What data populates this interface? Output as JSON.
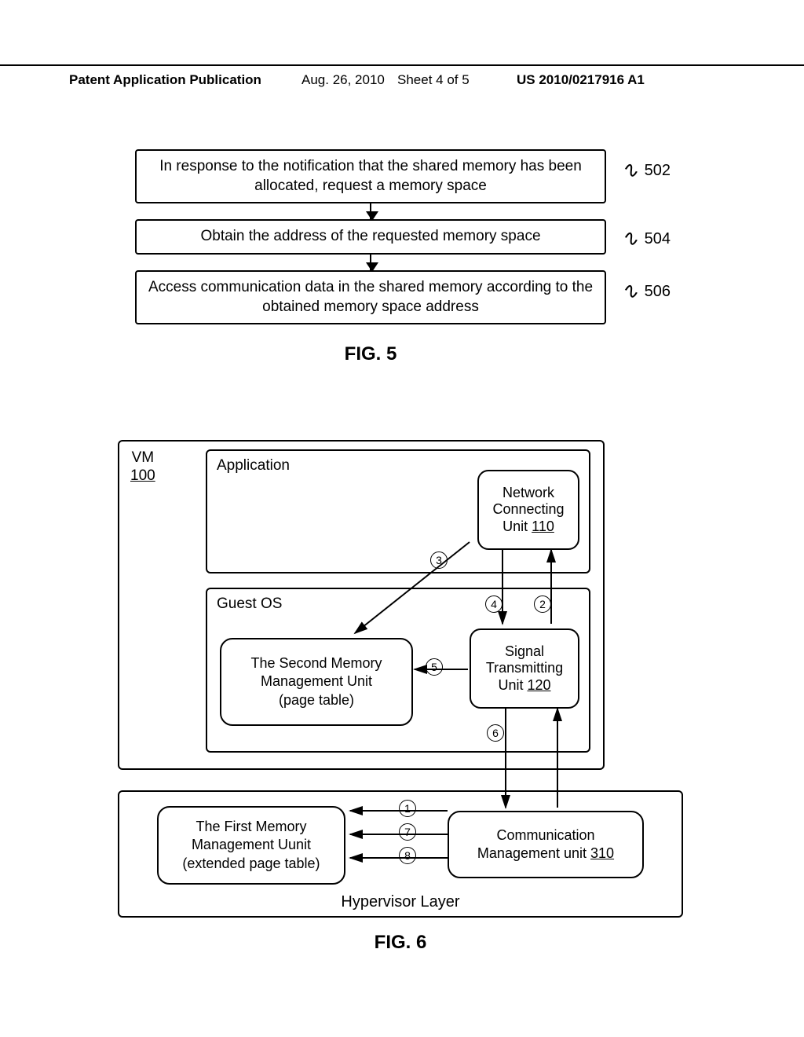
{
  "header": {
    "pub": "Patent Application Publication",
    "date": "Aug. 26, 2010",
    "sheet": "Sheet 4 of 5",
    "pubnum": "US 2010/0217916 A1"
  },
  "fig5": {
    "step1": "In response to the notification that the shared memory has been allocated, request a  memory space",
    "step2": "Obtain the address of the requested memory space",
    "step3": "Access communication data in the shared memory according to the obtained memory space address",
    "ref1": "502",
    "ref2": "504",
    "ref3": "506",
    "caption": "FIG. 5"
  },
  "fig6": {
    "vm": "VM",
    "vm_id": "100",
    "app": "Application",
    "ncu_l1": "Network",
    "ncu_l2": "Connecting",
    "ncu_l3": "Unit ",
    "ncu_id": "110",
    "os": "Guest OS",
    "smm_l1": "The Second Memory",
    "smm_l2": "Management Unit",
    "smm_l3": "(page table)",
    "stu_l1": "Signal",
    "stu_l2": "Transmitting",
    "stu_l3": "Unit ",
    "stu_id": "120",
    "fmm_l1": "The First Memory",
    "fmm_l2": "Management Uunit",
    "fmm_l3": "(extended page table)",
    "cmu_l1": "Communication",
    "cmu_l2": "Management unit ",
    "cmu_id": "310",
    "hyp": "Hypervisor Layer",
    "n1": "1",
    "n2": "2",
    "n3": "3",
    "n4": "4",
    "n5": "5",
    "n6": "6",
    "n7": "7",
    "n8": "8",
    "caption": "FIG. 6"
  }
}
